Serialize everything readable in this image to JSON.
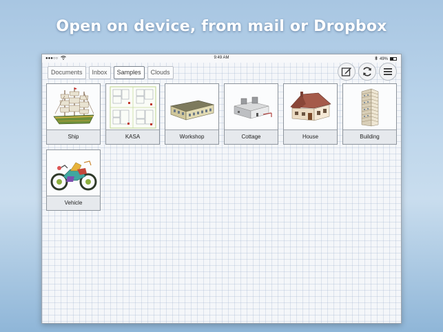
{
  "headline": "Open on device, from mail or Dropbox",
  "statusbar": {
    "time": "9:49 AM",
    "battery": "49%",
    "signal_icon": "signal-dots-icon",
    "wifi_icon": "wifi-icon",
    "bluetooth_icon": "bluetooth-icon"
  },
  "tabs": [
    {
      "label": "Documents",
      "active": false
    },
    {
      "label": "Inbox",
      "active": false
    },
    {
      "label": "Samples",
      "active": true
    },
    {
      "label": "Clouds",
      "active": false
    }
  ],
  "toolbar": {
    "edit_icon": "edit-icon",
    "sync_icon": "sync-icon",
    "menu_icon": "menu-icon"
  },
  "items": [
    {
      "label": "Ship",
      "icon": "ship-icon"
    },
    {
      "label": "KASA",
      "icon": "blueprint-icon"
    },
    {
      "label": "Workshop",
      "icon": "workshop-icon"
    },
    {
      "label": "Cottage",
      "icon": "cottage-icon"
    },
    {
      "label": "House",
      "icon": "house-icon"
    },
    {
      "label": "Building",
      "icon": "building-icon"
    },
    {
      "label": "Vehicle",
      "icon": "motorcycle-icon"
    }
  ],
  "colors": {
    "accent": "#7a828c",
    "sky": "#b9d3ea"
  }
}
